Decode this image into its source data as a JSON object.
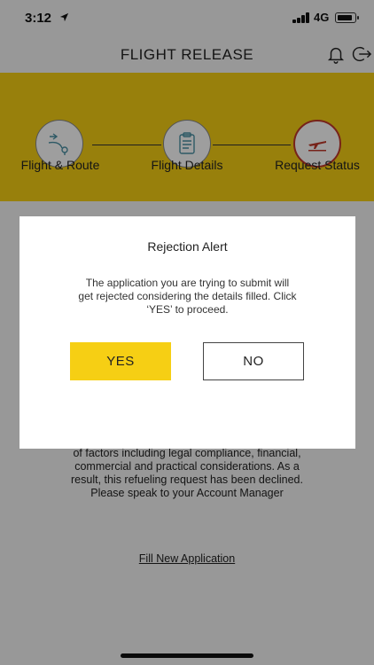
{
  "status_bar": {
    "time": "3:12",
    "network": "4G"
  },
  "header": {
    "title": "FLIGHT RELEASE",
    "icons": [
      "bell-icon",
      "logout-icon"
    ]
  },
  "stepper": {
    "steps": [
      {
        "label": "Flight & Route",
        "icon": "flight-route-icon"
      },
      {
        "label": "Flight Details",
        "icon": "flight-details-icon"
      },
      {
        "label": "Request Status",
        "icon": "request-status-icon",
        "active": true
      }
    ]
  },
  "content": {
    "message_lines": [
      "of factors including legal compliance, financial,",
      "commercial and practical considerations. As a",
      "result, this refueling request has been declined.",
      "Please speak to your Account Manager"
    ],
    "fill_link": "Fill New Application"
  },
  "modal": {
    "title": "Rejection Alert",
    "message_lines": [
      "The application you are trying to submit will",
      "get rejected considering the details filled. Click",
      "‘YES’ to proceed."
    ],
    "yes_label": "YES",
    "no_label": "NO"
  },
  "colors": {
    "accent": "#f6cf14",
    "active_step": "#c0392b"
  }
}
